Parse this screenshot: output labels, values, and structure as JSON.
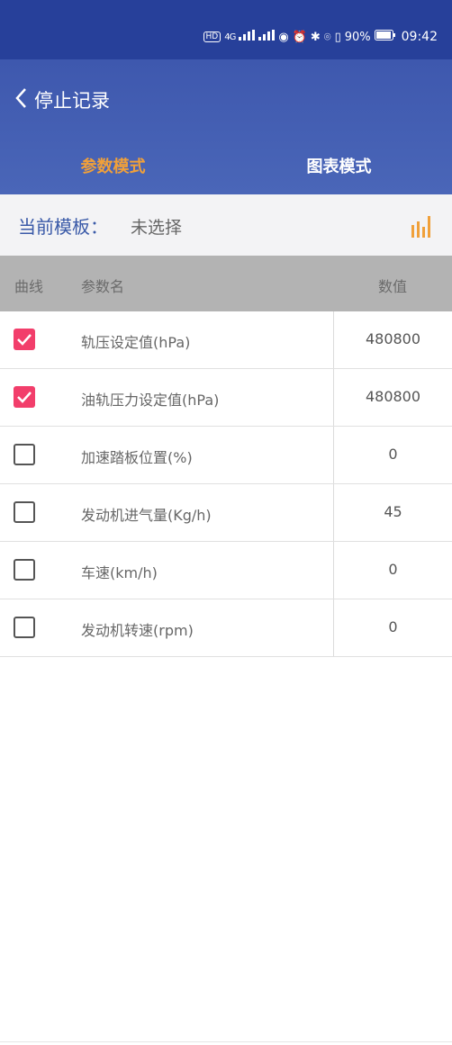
{
  "status_bar": {
    "signal_text": "4G",
    "battery_percent": "90%",
    "time": "09:42"
  },
  "header": {
    "back_label": "停止记录",
    "tabs": [
      {
        "label": "参数模式",
        "active": true
      },
      {
        "label": "图表模式",
        "active": false
      }
    ]
  },
  "template": {
    "label": "当前模板：",
    "value": "未选择"
  },
  "table": {
    "headers": {
      "curve": "曲线",
      "name": "参数名",
      "value": "数值"
    },
    "rows": [
      {
        "checked": true,
        "name": "轨压设定值(hPa)",
        "value": "480800"
      },
      {
        "checked": true,
        "name": "油轨压力设定值(hPa)",
        "value": "480800"
      },
      {
        "checked": false,
        "name": "加速踏板位置(%)",
        "value": "0"
      },
      {
        "checked": false,
        "name": "发动机进气量(Kg/h)",
        "value": "45"
      },
      {
        "checked": false,
        "name": "车速(km/h)",
        "value": "0"
      },
      {
        "checked": false,
        "name": "发动机转速(rpm)",
        "value": "0"
      }
    ]
  },
  "colors": {
    "status_bar": "#27409a",
    "header": "#4a66b8",
    "active_tab": "#f0a03a",
    "checkbox_checked": "#f23e6b",
    "template_label": "#3a5aa8",
    "chart_icon": "#f0a03a"
  },
  "icons": {
    "back": "chevron-left-icon",
    "chart": "bar-chart-icon",
    "checkbox_check": "check-icon"
  }
}
